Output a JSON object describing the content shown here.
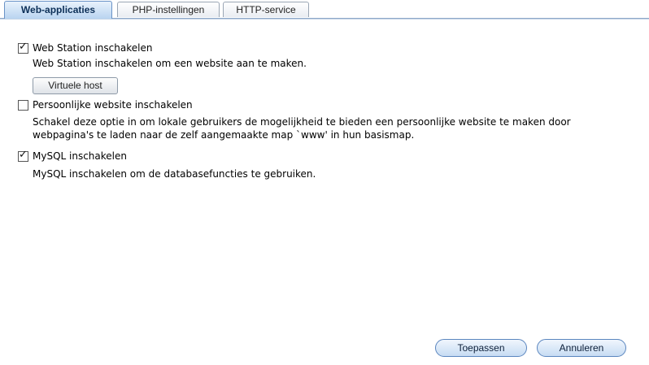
{
  "tabs": [
    {
      "label": "Web-applicaties",
      "active": true
    },
    {
      "label": "PHP-instellingen",
      "active": false
    },
    {
      "label": "HTTP-service",
      "active": false
    }
  ],
  "options": {
    "web_station": {
      "label": "Web Station inschakelen",
      "checked": true,
      "description": "Web Station inschakelen om een website aan te maken."
    },
    "virtual_host_button": "Virtuele host",
    "personal_website": {
      "label": "Persoonlijke website inschakelen",
      "checked": false,
      "description_line1": "Schakel deze optie in om lokale gebruikers de mogelijkheid te bieden een persoonlijke website te maken door",
      "description_line2": "webpagina's te laden naar de zelf aangemaakte map `www' in hun basismap."
    },
    "mysql": {
      "label": "MySQL inschakelen",
      "checked": true,
      "description": "MySQL inschakelen om de databasefuncties te gebruiken."
    }
  },
  "footer": {
    "apply_label": "Toepassen",
    "cancel_label": "Annuleren"
  },
  "glyphs": {
    "checkmark": "✓"
  }
}
